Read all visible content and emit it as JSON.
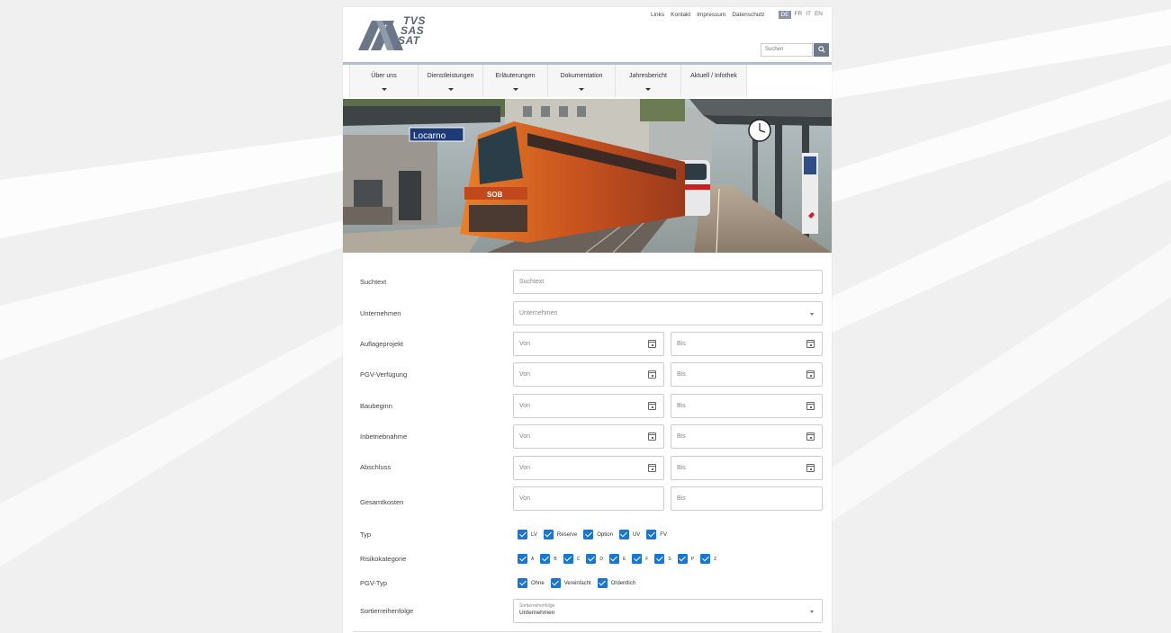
{
  "header": {
    "logo_lines": [
      "TVS",
      "SAS",
      "SAT"
    ],
    "top_links": [
      "Links",
      "Kontakt",
      "Impressum",
      "Datenschutz"
    ],
    "languages": [
      {
        "code": "DE",
        "active": true
      },
      {
        "code": "FR",
        "active": false
      },
      {
        "code": "IT",
        "active": false
      },
      {
        "code": "EN",
        "active": false
      }
    ],
    "search_placeholder": "Suchen",
    "search_icon": "search-icon"
  },
  "nav": [
    "Über uns",
    "Dienstleistungen",
    "Erläuterungen",
    "Dokumentation",
    "Jahresbericht",
    "Aktuell / Infothek"
  ],
  "hero": {
    "station_sign": "Locarno",
    "train_logo": "SOB"
  },
  "form": {
    "suchtext": {
      "label": "Suchtext",
      "placeholder": "Suchtext"
    },
    "unternehmen": {
      "label": "Unternehmen",
      "placeholder": "Unternehmen"
    },
    "date_ranges": [
      {
        "label": "Auflageprojekt",
        "from": "Von",
        "to": "Bis"
      },
      {
        "label": "PGV-Verfügung",
        "from": "Von",
        "to": "Bis"
      },
      {
        "label": "Baubeginn",
        "from": "Von",
        "to": "Bis"
      },
      {
        "label": "Inbetriebnahme",
        "from": "Von",
        "to": "Bis"
      },
      {
        "label": "Abschluss",
        "from": "Von",
        "to": "Bis"
      }
    ],
    "gesamtkosten": {
      "label": "Gesamtkosten",
      "from": "Von",
      "to": "Bis"
    },
    "typ": {
      "label": "Typ",
      "options": [
        "LV",
        "Reserve",
        "Option",
        "UV",
        "FV"
      ]
    },
    "risikokategorie": {
      "label": "Risikokategorie",
      "options": [
        "A",
        "B",
        "C",
        "D",
        "E",
        "F",
        "S",
        "P",
        "Z"
      ]
    },
    "pgv_typ": {
      "label": "PGV-Typ",
      "options": [
        "Ohne",
        "Vereinfacht",
        "Ordentlich"
      ]
    },
    "sortierreihenfolge": {
      "label": "Sortierreihenfolge",
      "field_label": "Sortierreihenfolge",
      "value": "Unternehmen"
    }
  },
  "colors": {
    "checkbox": "#1976d2",
    "nav_accent": "#a9bdd6",
    "lang_active": "#8a94a6",
    "background": "#f0f0f0"
  }
}
